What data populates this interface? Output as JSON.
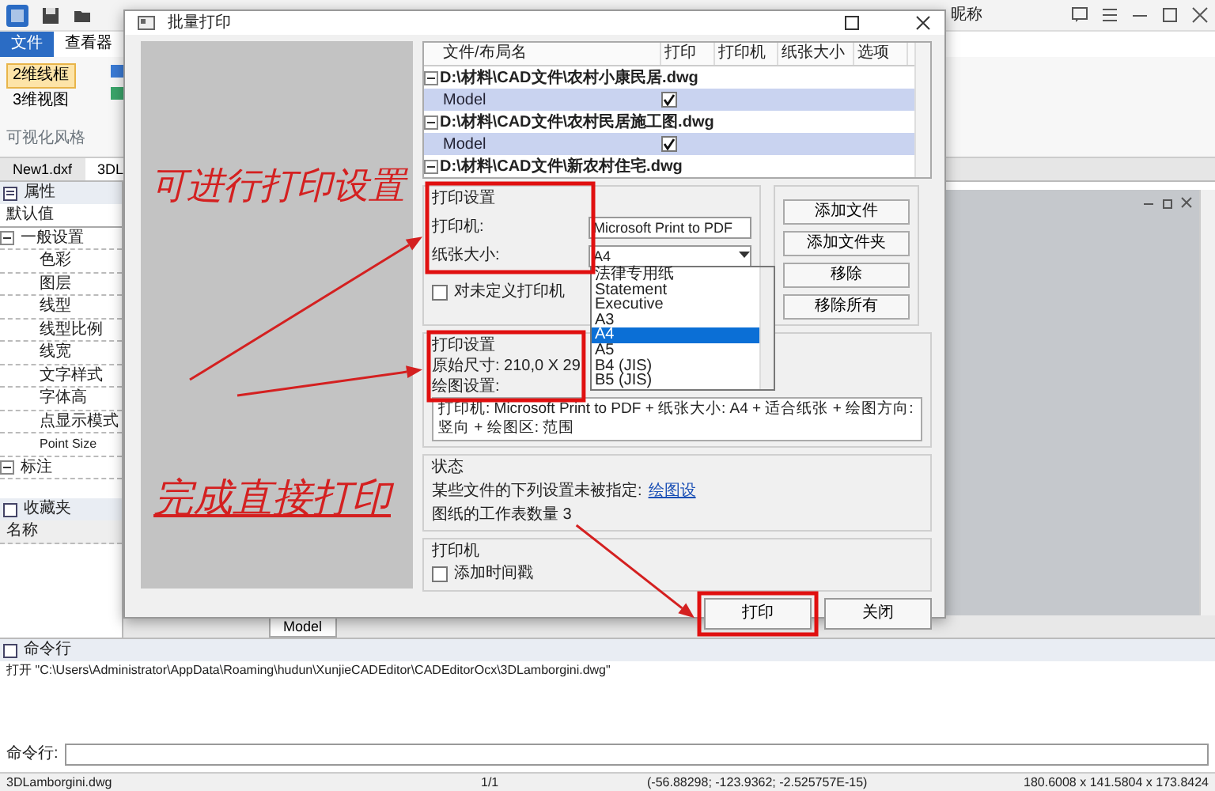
{
  "app": {
    "account": "昵称",
    "ribbon_tabs": [
      {
        "label": "文件",
        "selected": true
      },
      {
        "label": "查看器",
        "selected": false
      }
    ],
    "view_buttons": [
      {
        "label": "2维线框",
        "selected": true
      },
      {
        "label": "3维视图",
        "selected": false
      }
    ],
    "ribbon_group": "可视化风格",
    "doc_tabs": [
      {
        "label": "New1.dxf",
        "selected": false
      },
      {
        "label": "3DL",
        "selected": true
      }
    ]
  },
  "properties": {
    "title": "属性",
    "default": "默认值",
    "groups": [
      {
        "label": "一般设置",
        "expanded": true,
        "children": [
          "色彩",
          "图层",
          "线型",
          "线型比例",
          "线宽",
          "文字样式",
          "字体高",
          "点显示模式",
          "Point Size"
        ]
      },
      {
        "label": "标注",
        "expanded": true
      }
    ]
  },
  "favorites": {
    "title": "收藏夹",
    "column": "名称"
  },
  "canvas": {
    "layout_tab": "Model"
  },
  "command": {
    "title": "命令行",
    "output": "打开 \"C:\\Users\\Administrator\\AppData\\Roaming\\hudun\\XunjieCADEditor\\CADEditorOcx\\3DLamborgini.dwg\"",
    "prompt": "命令行:"
  },
  "status_bar": [
    "3DLamborgini.dwg",
    "1/1",
    "(-56.88298; -123.9362; -2.525757E-15)",
    "180.6008 x 141.5804 x 173.8424"
  ],
  "dialog": {
    "title": "批量打印",
    "file_table": {
      "columns": [
        "文件/布局名",
        "打印",
        "打印机",
        "纸张大小",
        "选项"
      ],
      "rows": [
        {
          "kind": "file",
          "name": "D:\\材料\\CAD文件\\农村小康民居.dwg",
          "expanded": true
        },
        {
          "kind": "layout",
          "name": "Model",
          "print": true
        },
        {
          "kind": "file",
          "name": "D:\\材料\\CAD文件\\农村民居施工图.dwg",
          "expanded": true
        },
        {
          "kind": "layout",
          "name": "Model",
          "print": true
        },
        {
          "kind": "file",
          "name": "D:\\材料\\CAD文件\\新农村住宅.dwg",
          "expanded": true
        }
      ]
    },
    "print_settings": {
      "title": "打印设置",
      "printer_label": "打印机:",
      "printer": "Microsoft Print to PDF",
      "paper_label": "纸张大小:",
      "paper": "A4",
      "undefined_printer": {
        "label": "对未定义打印机",
        "checked": false
      },
      "paper_options": [
        {
          "label": "法律专用纸",
          "selected": false
        },
        {
          "label": "Statement",
          "selected": false
        },
        {
          "label": "Executive",
          "selected": false
        },
        {
          "label": "A3",
          "selected": false
        },
        {
          "label": "A4",
          "selected": true
        },
        {
          "label": "A5",
          "selected": false
        },
        {
          "label": "B4 (JIS)",
          "selected": false
        },
        {
          "label": "B5 (JIS)",
          "selected": false
        }
      ]
    },
    "file_buttons": [
      "添加文件",
      "添加文件夹",
      "移除",
      "移除所有"
    ],
    "plot_settings": {
      "title": "打印设置",
      "original_size": "原始尺寸: 210,0 X 29",
      "plot_label": "绘图设置:",
      "summary": "打印机: Microsoft Print to PDF + 纸张大小: A4 + 适合纸张 + 绘图方向: 竖向 + 绘图区: 范围"
    },
    "status": {
      "title": "状态",
      "unset_text": "某些文件的下列设置未被指定:",
      "unset_link": "绘图设",
      "sheet_count": "图纸的工作表数量 3"
    },
    "printer_group": {
      "title": "打印机",
      "timestamp": {
        "label": "添加时间戳",
        "checked": false
      }
    },
    "buttons": [
      "打印",
      "关闭"
    ]
  },
  "annotations": [
    "可进行打印设置",
    "完成直接打印"
  ]
}
